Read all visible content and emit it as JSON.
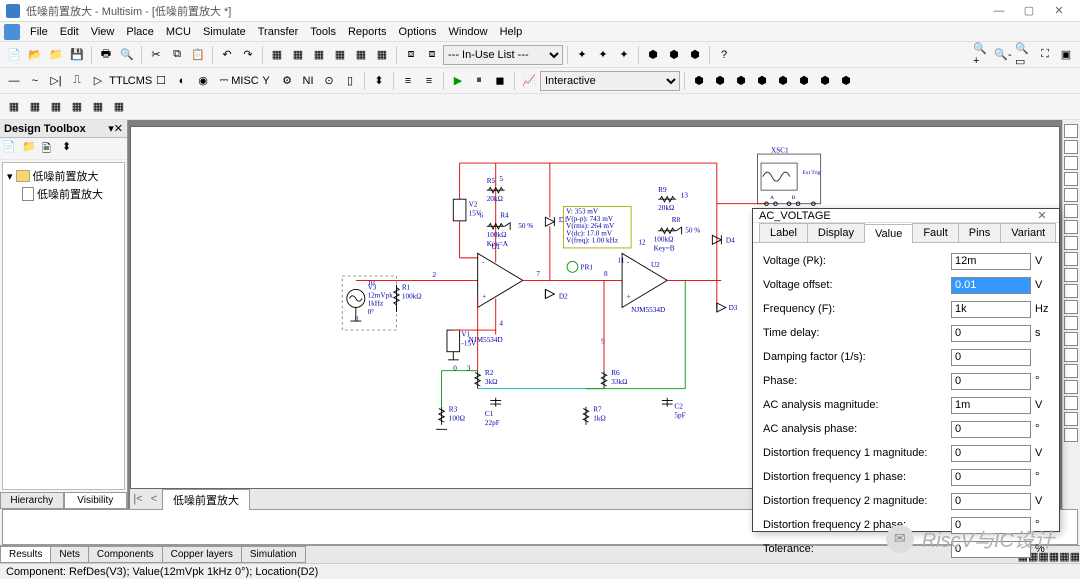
{
  "app": {
    "title": "低噪前置放大 - Multisim - [低噪前置放大 *]"
  },
  "menus": [
    "File",
    "Edit",
    "View",
    "Place",
    "MCU",
    "Simulate",
    "Transfer",
    "Tools",
    "Reports",
    "Options",
    "Window",
    "Help"
  ],
  "in_use_list": "--- In-Use List ---",
  "interactive_label": "Interactive",
  "design_toolbox": {
    "title": "Design Toolbox",
    "project": "低噪前置放大",
    "sheet": "低噪前置放大",
    "tabs": [
      "Hierarchy",
      "Visibility"
    ]
  },
  "sheet_tab": "低噪前置放大",
  "sheet_nav": [
    "|<",
    "<"
  ],
  "bottom_tabs": [
    "Results",
    "Nets",
    "Components",
    "Copper layers",
    "Simulation"
  ],
  "statusbar": "Component: RefDes(V3); Value(12mVpk  1kHz  0°); Location(D2)",
  "schematic": {
    "labels": {
      "V3": {
        "ref": "V3",
        "l1": "12mVpk",
        "l2": "1kHz",
        "l3": "0°"
      },
      "R1": {
        "ref": "R1",
        "val": "100kΩ"
      },
      "V2": {
        "ref": "V2",
        "val": "15V"
      },
      "V1": {
        "ref": "V1",
        "val": "-15V"
      },
      "R5": {
        "ref": "R5",
        "val": "20kΩ"
      },
      "R4": {
        "ref": "R4",
        "val": "100kΩ",
        "key": "Key=A",
        "pct": "50 %"
      },
      "U1": {
        "ref": "U1",
        "part": "NJM5534D"
      },
      "R2": {
        "ref": "R2",
        "val": "3kΩ"
      },
      "R3": {
        "ref": "R3",
        "val": "100Ω"
      },
      "C1": {
        "ref": "C1",
        "val": "22pF"
      },
      "D1": "D1",
      "D2": "D2",
      "D3": "D3",
      "D4": "D4",
      "PR1": "PR1",
      "R9": {
        "ref": "R9",
        "val": "20kΩ"
      },
      "R8": {
        "ref": "R8",
        "val": "100kΩ",
        "key": "Key=B",
        "pct": "50 %"
      },
      "U2": {
        "ref": "U2",
        "part": "NJM5534D"
      },
      "R6": {
        "ref": "R6",
        "val": "33kΩ"
      },
      "R7": {
        "ref": "R7",
        "val": "1kΩ"
      },
      "C2": {
        "ref": "C2",
        "val": "5pF"
      },
      "XSC1": "XSC1",
      "banner": {
        "l1": "V: 353 mV",
        "l2": "V(p-p): 743 mV",
        "l3": "V(rms): 264 mV",
        "l4": "V(dc): 17.0 mV",
        "l5": "V(freq): 1.00 kHz"
      }
    },
    "nodes": {
      "n1": "1",
      "n2": "2",
      "n3": "3",
      "n4": "4",
      "n5": "5",
      "n6": "6",
      "n7": "7",
      "n8": "8",
      "n9": "9",
      "n10": "10",
      "n11": "11",
      "n12": "12",
      "n13": "13",
      "n0": "0"
    }
  },
  "dialog": {
    "title": "AC_VOLTAGE",
    "tabs": [
      "Label",
      "Display",
      "Value",
      "Fault",
      "Pins",
      "Variant"
    ],
    "active_tab": "Value",
    "fields": [
      {
        "k": "Voltage (Pk):",
        "v": "12m",
        "u": "V"
      },
      {
        "k": "Voltage offset:",
        "v": "0.01",
        "u": "V",
        "sel": true
      },
      {
        "k": "Frequency (F):",
        "v": "1k",
        "u": "Hz"
      },
      {
        "k": "Time delay:",
        "v": "0",
        "u": "s"
      },
      {
        "k": "Damping factor (1/s):",
        "v": "0",
        "u": ""
      },
      {
        "k": "Phase:",
        "v": "0",
        "u": "°"
      },
      {
        "k": "AC analysis magnitude:",
        "v": "1m",
        "u": "V"
      },
      {
        "k": "AC analysis phase:",
        "v": "0",
        "u": "°"
      },
      {
        "k": "Distortion frequency 1 magnitude:",
        "v": "0",
        "u": "V"
      },
      {
        "k": "Distortion frequency 1 phase:",
        "v": "0",
        "u": "°"
      },
      {
        "k": "Distortion frequency 2 magnitude:",
        "v": "0",
        "u": "V"
      },
      {
        "k": "Distortion frequency 2 phase:",
        "v": "0",
        "u": "°"
      },
      {
        "k": "Tolerance:",
        "v": "0",
        "u": "%"
      }
    ]
  },
  "watermark": "RiscV与IC设计"
}
